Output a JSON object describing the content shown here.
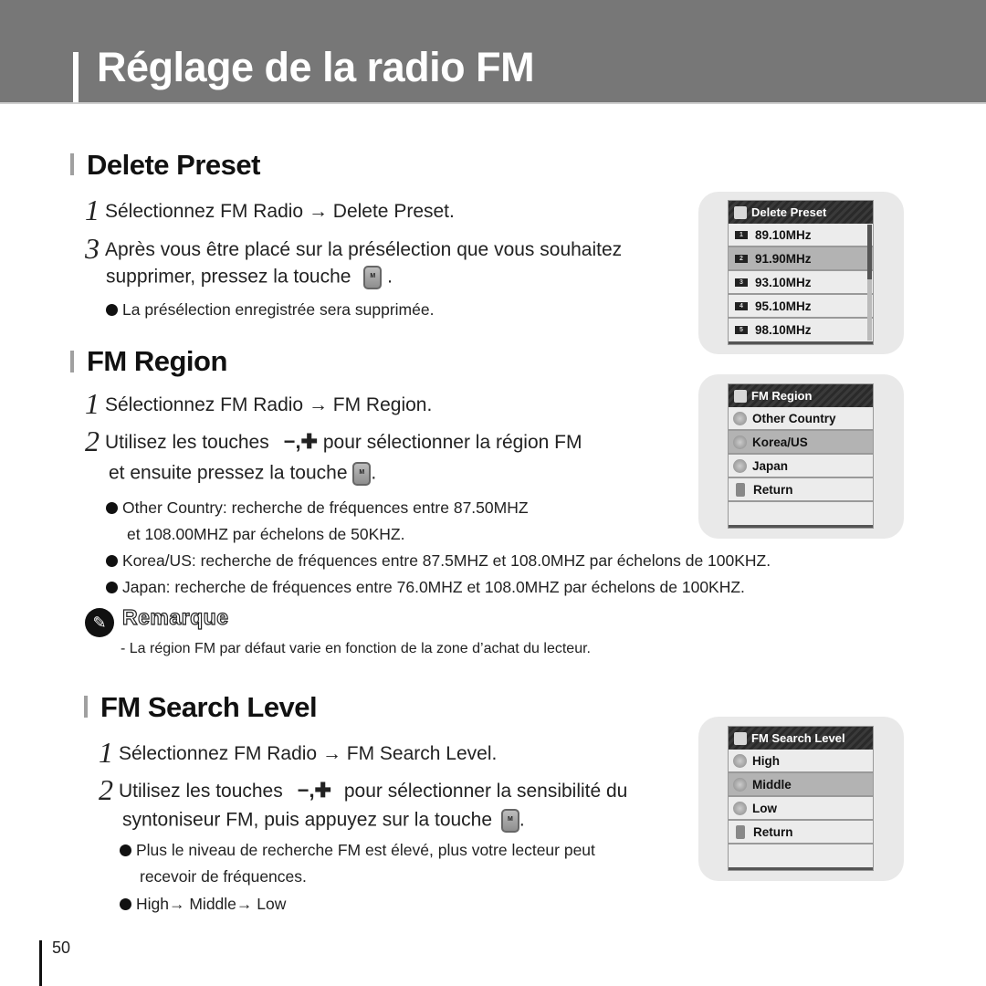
{
  "page": {
    "title": "Réglage de la radio FM",
    "page_number": "50"
  },
  "key_label": "M",
  "sections": {
    "delete_preset": {
      "heading": "Delete Preset",
      "steps": [
        {
          "num": "1",
          "text": "Sélectionnez FM Radio → Delete Preset."
        },
        {
          "num": "3",
          "text": "Après vous être placé sur la présélection que vous souhaitez",
          "cont": "supprimer, pressez la touche",
          "cont_end": "."
        }
      ],
      "bullets": [
        "La présélection enregistrée sera supprimée."
      ],
      "screen": {
        "title": "Delete Preset",
        "items": [
          {
            "badge": "1",
            "label": "89.10MHz",
            "selected": false
          },
          {
            "badge": "2",
            "label": "91.90MHz",
            "selected": true
          },
          {
            "badge": "3",
            "label": "93.10MHz",
            "selected": false
          },
          {
            "badge": "4",
            "label": "95.10MHz",
            "selected": false
          },
          {
            "badge": "5",
            "label": "98.10MHz",
            "selected": false
          }
        ]
      }
    },
    "fm_region": {
      "heading": "FM Region",
      "steps": [
        {
          "num": "1",
          "text": "Sélectionnez FM Radio → FM Region."
        },
        {
          "num": "2",
          "text_before": "Utilisez les touches",
          "keys": "−,✚",
          "text_after": "pour sélectionner la région FM",
          "cont": "et ensuite pressez la touche",
          "cont_end": "."
        }
      ],
      "bullets": [
        "Other Country: recherche de fréquences entre 87.50MHZ",
        "et 108.00MHZ par échelons de 50KHZ.",
        "Korea/US: recherche de fréquences entre 87.5MHZ et 108.0MHZ par échelons de 100KHZ.",
        "Japan: recherche de fréquences entre 76.0MHZ et 108.0MHZ par échelons de 100KHZ."
      ],
      "screen": {
        "title": "FM Region",
        "items": [
          {
            "icon": "globe-icon",
            "label": "Other Country",
            "selected": false
          },
          {
            "icon": "globe-icon",
            "label": "Korea/US",
            "selected": true
          },
          {
            "icon": "globe-icon",
            "label": "Japan",
            "selected": false
          },
          {
            "icon": "return-icon",
            "label": "Return",
            "selected": false
          }
        ]
      }
    },
    "remark": {
      "title": "Remarque",
      "text": "- La région FM par défaut varie en fonction de la zone d’achat du lecteur."
    },
    "fm_search_level": {
      "heading": "FM Search Level",
      "steps": [
        {
          "num": "1",
          "text": "Sélectionnez FM Radio → FM Search Level."
        },
        {
          "num": "2",
          "text_before": "Utilisez les touches",
          "keys": "−,✚",
          "text_after": "pour sélectionner la sensibilité du",
          "cont": "syntoniseur FM, puis appuyez sur la touche",
          "cont_end": "."
        }
      ],
      "bullets": [
        "Plus le niveau de recherche FM est élevé, plus votre lecteur peut",
        "recevoir de fréquences.",
        "High→ Middle→ Low"
      ],
      "screen": {
        "title": "FM Search Level",
        "items": [
          {
            "icon": "level-icon",
            "label": "High",
            "selected": false
          },
          {
            "icon": "level-icon",
            "label": "Middle",
            "selected": true
          },
          {
            "icon": "level-icon",
            "label": "Low",
            "selected": false
          },
          {
            "icon": "return-icon",
            "label": "Return",
            "selected": false
          }
        ]
      }
    }
  }
}
